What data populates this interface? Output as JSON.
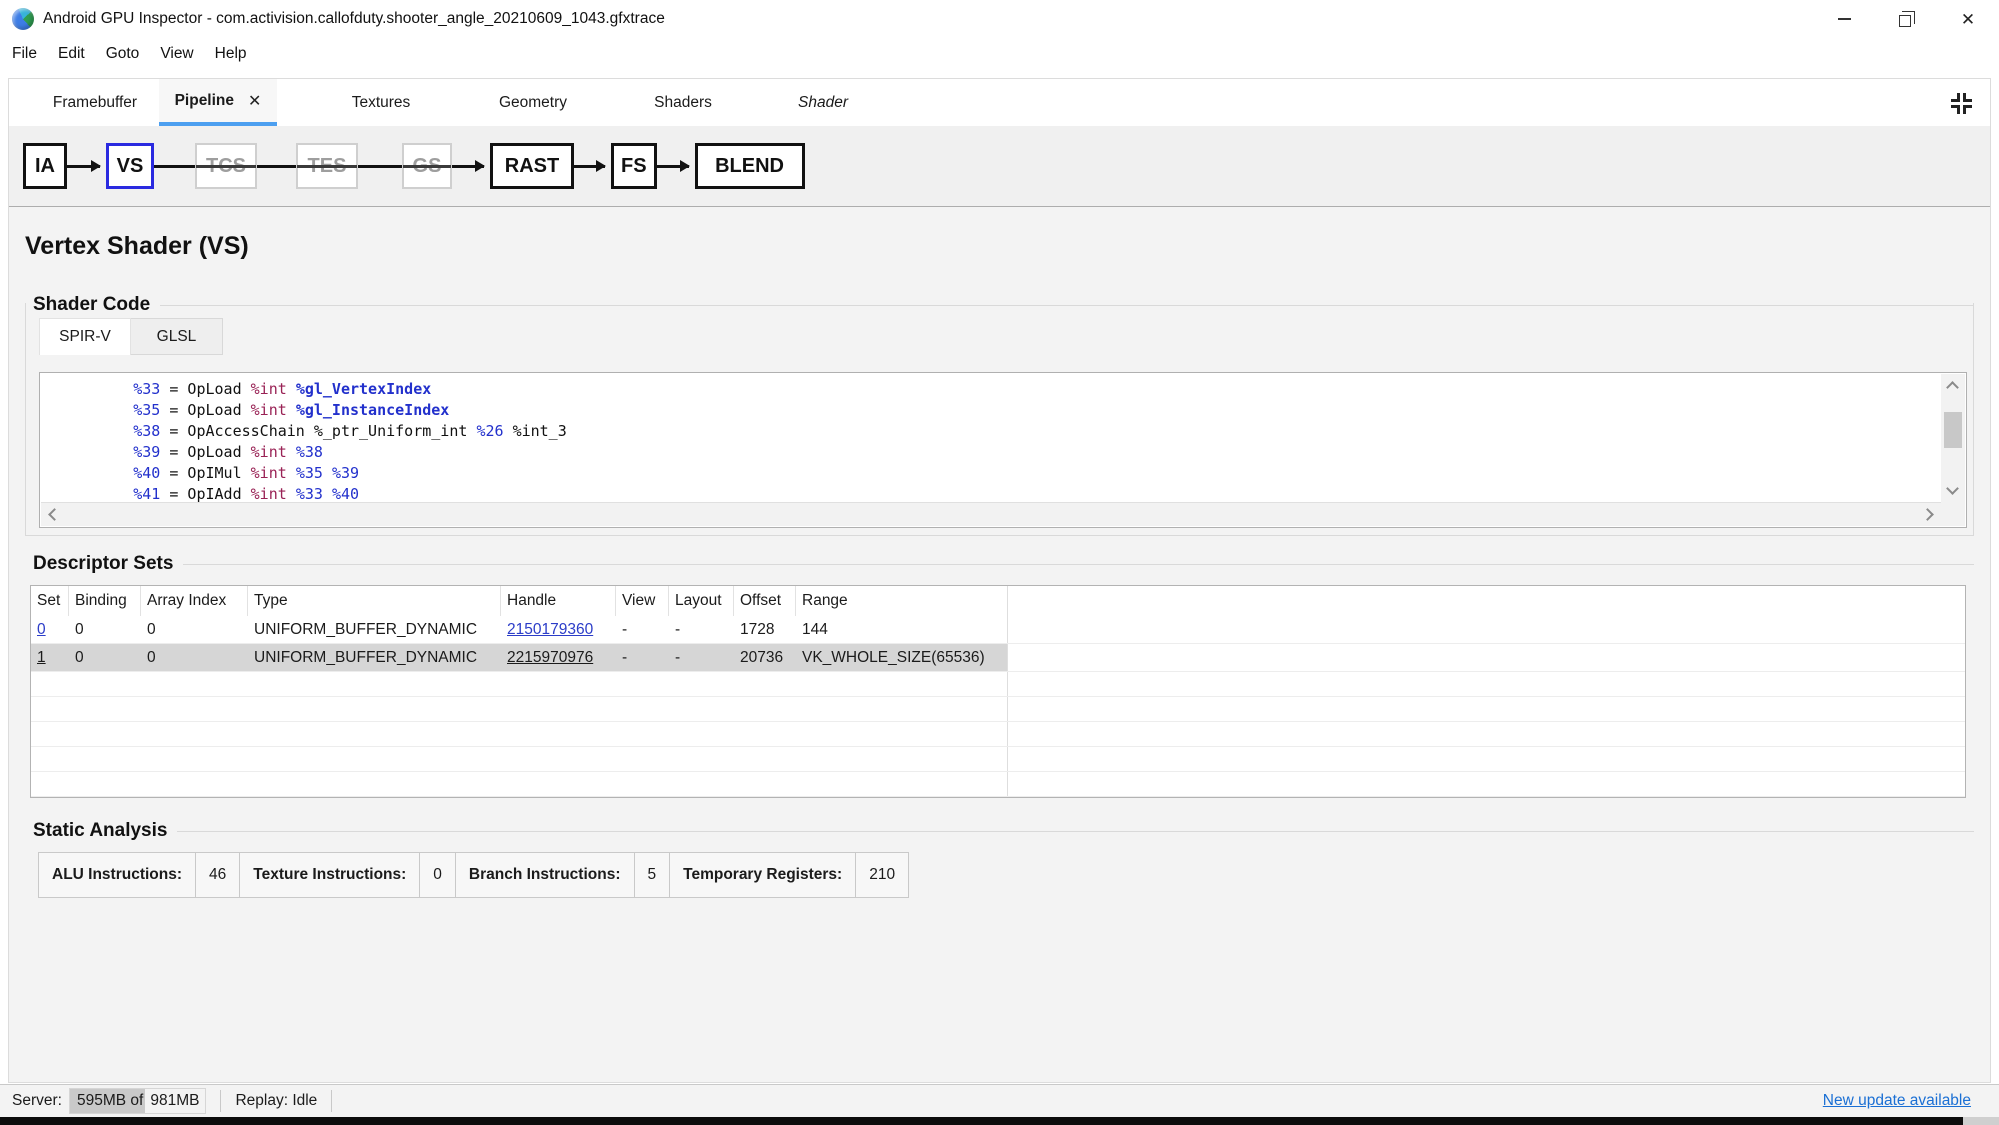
{
  "window": {
    "title": "Android GPU Inspector - com.activision.callofduty.shooter_angle_20210609_1043.gfxtrace"
  },
  "menu": {
    "items": [
      "File",
      "Edit",
      "Goto",
      "View",
      "Help"
    ]
  },
  "tab_bar": {
    "tabs": [
      {
        "label": "Framebuffer",
        "active": false,
        "closable": false,
        "italic": false
      },
      {
        "label": "Pipeline",
        "active": true,
        "closable": true,
        "italic": false
      },
      {
        "label": "Textures",
        "active": false,
        "closable": false,
        "italic": false
      },
      {
        "label": "Geometry",
        "active": false,
        "closable": false,
        "italic": false
      },
      {
        "label": "Shaders",
        "active": false,
        "closable": false,
        "italic": false
      },
      {
        "label": "Shader",
        "active": false,
        "closable": false,
        "italic": true
      }
    ],
    "close_icon": "✕",
    "collapse_icon": "collapse-panes"
  },
  "pipeline": {
    "stages": [
      {
        "label": "IA",
        "state": "enabled"
      },
      {
        "label": "VS",
        "state": "selected"
      },
      {
        "label": "TCS",
        "state": "disabled"
      },
      {
        "label": "TES",
        "state": "disabled"
      },
      {
        "label": "GS",
        "state": "disabled"
      },
      {
        "label": "RAST",
        "state": "enabled"
      },
      {
        "label": "FS",
        "state": "enabled"
      },
      {
        "label": "BLEND",
        "state": "enabled"
      }
    ]
  },
  "page": {
    "title": "Vertex Shader (VS)"
  },
  "shader_code": {
    "heading": "Shader Code",
    "tabs": [
      {
        "label": "SPIR-V",
        "active": true
      },
      {
        "label": "GLSL",
        "active": false
      }
    ],
    "lines": [
      {
        "tokens": [
          {
            "t": "        ",
            "k": "p"
          },
          {
            "t": "%33",
            "k": "id"
          },
          {
            "t": " = OpLoad ",
            "k": "p"
          },
          {
            "t": "%int",
            "k": "ty"
          },
          {
            "t": " ",
            "k": "p"
          },
          {
            "t": "%gl_VertexIndex",
            "k": "bi"
          }
        ]
      },
      {
        "tokens": [
          {
            "t": "        ",
            "k": "p"
          },
          {
            "t": "%35",
            "k": "id"
          },
          {
            "t": " = OpLoad ",
            "k": "p"
          },
          {
            "t": "%int",
            "k": "ty"
          },
          {
            "t": " ",
            "k": "p"
          },
          {
            "t": "%gl_InstanceIndex",
            "k": "bi"
          }
        ]
      },
      {
        "tokens": [
          {
            "t": "        ",
            "k": "p"
          },
          {
            "t": "%38",
            "k": "id"
          },
          {
            "t": " = OpAccessChain ",
            "k": "p"
          },
          {
            "t": "%_ptr_Uniform_int",
            "k": "p"
          },
          {
            "t": " ",
            "k": "p"
          },
          {
            "t": "%26",
            "k": "id"
          },
          {
            "t": " ",
            "k": "p"
          },
          {
            "t": "%int_3",
            "k": "p"
          }
        ]
      },
      {
        "tokens": [
          {
            "t": "        ",
            "k": "p"
          },
          {
            "t": "%39",
            "k": "id"
          },
          {
            "t": " = OpLoad ",
            "k": "p"
          },
          {
            "t": "%int",
            "k": "ty"
          },
          {
            "t": " ",
            "k": "p"
          },
          {
            "t": "%38",
            "k": "id"
          }
        ]
      },
      {
        "tokens": [
          {
            "t": "        ",
            "k": "p"
          },
          {
            "t": "%40",
            "k": "id"
          },
          {
            "t": " = OpIMul ",
            "k": "p"
          },
          {
            "t": "%int",
            "k": "ty"
          },
          {
            "t": " ",
            "k": "p"
          },
          {
            "t": "%35",
            "k": "id"
          },
          {
            "t": " ",
            "k": "p"
          },
          {
            "t": "%39",
            "k": "id"
          }
        ]
      },
      {
        "tokens": [
          {
            "t": "        ",
            "k": "p"
          },
          {
            "t": "%41",
            "k": "id"
          },
          {
            "t": " = OpIAdd ",
            "k": "p"
          },
          {
            "t": "%int",
            "k": "ty"
          },
          {
            "t": " ",
            "k": "p"
          },
          {
            "t": "%33",
            "k": "id"
          },
          {
            "t": " ",
            "k": "p"
          },
          {
            "t": "%40",
            "k": "id"
          }
        ]
      }
    ]
  },
  "descriptor_sets": {
    "heading": "Descriptor Sets",
    "columns": [
      "Set",
      "Binding",
      "Array Index",
      "Type",
      "Handle",
      "View",
      "Layout",
      "Offset",
      "Range"
    ],
    "rows": [
      {
        "selected": false,
        "cells": [
          {
            "t": "0",
            "link": "blue"
          },
          {
            "t": "0"
          },
          {
            "t": "0"
          },
          {
            "t": "UNIFORM_BUFFER_DYNAMIC"
          },
          {
            "t": "2150179360",
            "link": "blue"
          },
          {
            "t": "-"
          },
          {
            "t": "-"
          },
          {
            "t": "1728"
          },
          {
            "t": "144"
          }
        ]
      },
      {
        "selected": true,
        "cells": [
          {
            "t": "1",
            "link": "dark"
          },
          {
            "t": "0"
          },
          {
            "t": "0"
          },
          {
            "t": "UNIFORM_BUFFER_DYNAMIC"
          },
          {
            "t": "2215970976",
            "link": "dark"
          },
          {
            "t": "-"
          },
          {
            "t": "-"
          },
          {
            "t": "20736"
          },
          {
            "t": "VK_WHOLE_SIZE(65536)"
          }
        ]
      }
    ],
    "empty_row_count": 5
  },
  "static_analysis": {
    "heading": "Static Analysis",
    "metrics": [
      {
        "label": "ALU Instructions:",
        "value": "46"
      },
      {
        "label": "Texture Instructions:",
        "value": "0"
      },
      {
        "label": "Branch Instructions:",
        "value": "5"
      },
      {
        "label": "Temporary Registers:",
        "value": "210"
      }
    ]
  },
  "status_bar": {
    "server_label": "Server:",
    "server_used": "595MB of",
    "server_total": "981MB",
    "replay": "Replay: Idle",
    "update_link": "New update available"
  },
  "colors": {
    "tab_accent": "#4c9ff0",
    "table_link_blue": "#2b3cc8",
    "update_link_blue": "#1a6fd4",
    "code_id_blue": "#2230cc",
    "code_type_maroon": "#992255",
    "selected_row_gray": "#d6d6d6",
    "selected_stage_border": "#2a2ae0"
  }
}
